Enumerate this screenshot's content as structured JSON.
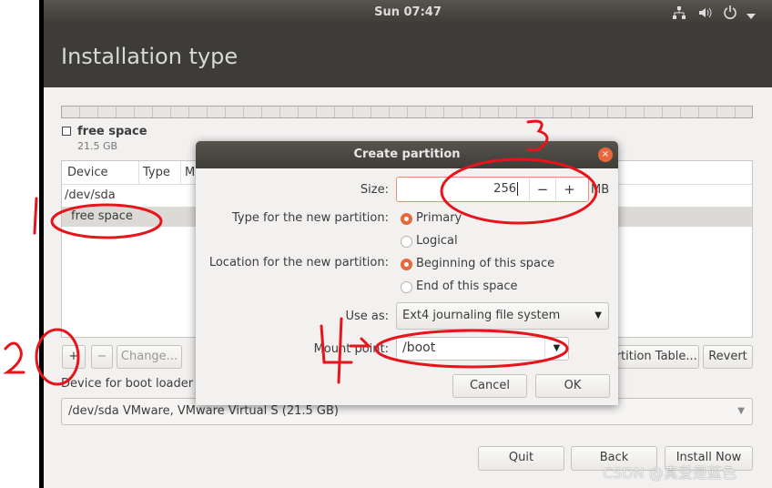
{
  "topbar": {
    "clock": "Sun 07:47",
    "icons": [
      "network-icon",
      "volume-icon",
      "power-icon",
      "chevron-down-icon"
    ]
  },
  "header": {
    "title": "Installation type"
  },
  "disk": {
    "free_label": "free space",
    "free_size": "21.5 GB"
  },
  "table": {
    "columns": [
      "Device",
      "Type",
      "M"
    ],
    "rows": [
      "/dev/sda",
      "free space"
    ],
    "selected": "free space"
  },
  "toolbar": {
    "add": "+",
    "remove": "−",
    "change": "Change...",
    "new_table": "New Partition Table...",
    "revert": "Revert"
  },
  "bootloader": {
    "label": "Device for boot loader installation:",
    "value": "/dev/sda VMware, VMware Virtual S (21.5 GB)"
  },
  "footer": {
    "quit": "Quit",
    "back": "Back",
    "install": "Install Now"
  },
  "dialog": {
    "title": "Create partition",
    "size_label": "Size:",
    "size_value": "256",
    "size_unit": "MB",
    "minus": "−",
    "plus": "+",
    "type_label": "Type for the new partition:",
    "type_options": [
      "Primary",
      "Logical"
    ],
    "type_selected": "Primary",
    "location_label": "Location for the new partition:",
    "location_options": [
      "Beginning of this space",
      "End of this space"
    ],
    "location_selected": "Beginning of this space",
    "useas_label": "Use as:",
    "useas_value": "Ext4 journaling file system",
    "mount_label": "Mount point:",
    "mount_value": "/boot",
    "cancel": "Cancel",
    "ok": "OK"
  },
  "annotations": {
    "color": "#e8141c",
    "numbers": [
      "1",
      "2",
      "3",
      "4"
    ]
  },
  "watermark": "CSDN @真爱是蓝色",
  "colors": {
    "accent": "#e8683b",
    "header": "#3d3c38",
    "background": "#f2f1f0"
  }
}
